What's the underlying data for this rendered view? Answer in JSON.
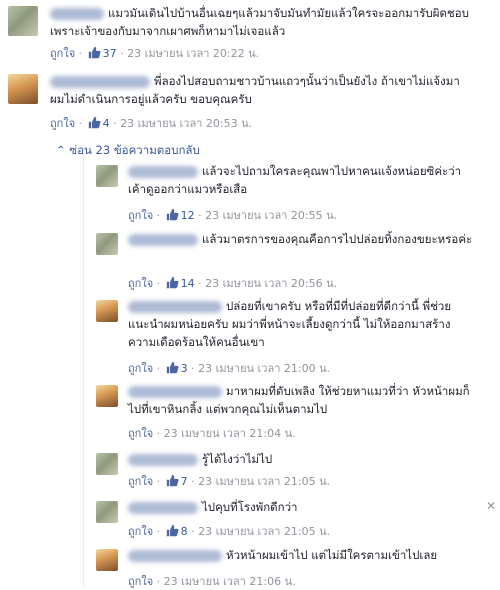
{
  "meta_labels": {
    "like": "ถูกใจ",
    "sep": "·"
  },
  "comments": [
    {
      "text": "แมวมันเดินไปบ้านอื่นเฉยๆแล้วมาจับมันทำมัยแล้วใครจะออกมารับผิดชอบเพราะเจ้าของกับมาจากเผาศพก็หามาไม่เจอแล้ว",
      "likes": "37",
      "date": "23 เมษายน เวลา 20:22 น."
    },
    {
      "text": "พี่ลองไปสอบถามชาวบ้านแถวๆนั้นว่าเป็นยังไง ถ้าเขาไม่แจ้งมาผมไม่ดำเนินการอยู่แล้วครับ ขอบคุณครับ",
      "likes": "4",
      "date": "23 เมษายน เวลา 20:53 น."
    }
  ],
  "hide_replies": {
    "icon": "chevron-up",
    "label": "ซ่อน 23 ข้อความตอบกลับ"
  },
  "replies": [
    {
      "text": "แล้วจะไปถามใครละคุณพาไปหาคนแจ้งหน่อยซิค่ะว่าเค้าดูออกว่าแมวหรือเสือ",
      "likes": "12",
      "date": "23 เมษายน เวลา 20:55 น."
    },
    {
      "text": "แล้วมาตรการของคุณคือการไปปล่อยทิ้งกองขยะหรอค่ะ",
      "likes": "14",
      "date": "23 เมษายน เวลา 20:56 น."
    },
    {
      "text": "ปล่อยที่เขาครับ หรือที่มีที่ปล่อยที่ดีกว่านี้ พี่ช่วยแนะนำผมหน่อยครับ ผมว่าพี่หน้าจะเลี้ยงดูกว่านี้ ไม่ให้ออกมาสร้างความเดือดร้อนให้คนอื่นเขา",
      "likes": "3",
      "date": "23 เมษายน เวลา 21:00 น."
    },
    {
      "text": "มาหาผมที่ดับเพลิง ให้ช่วยหาแมวที่ว่า หัวหน้าผมก็ไปที่เขาหินกลิ้ง แต่พวกคุณไม่เห็นตามไป",
      "likes": "",
      "date": "23 เมษายน เวลา 21:04 น."
    },
    {
      "text": "รู้ได้ไงว่าไม่ไป",
      "likes": "7",
      "date": "23 เมษายน เวลา 21:05 น."
    },
    {
      "text": "ไปคุบที่โรงพักดีกว่า",
      "likes": "8",
      "date": "23 เมษายน เวลา 21:05 น."
    },
    {
      "text": "หัวหน้าผมเข้าไป แต่ไม่มีใครตามเข้าไปเลย",
      "likes": "",
      "date": "23 เมษายน เวลา 21:06 น."
    }
  ],
  "colors": {
    "link": "#365899",
    "meta": "#90949c",
    "text": "#1d2129"
  }
}
